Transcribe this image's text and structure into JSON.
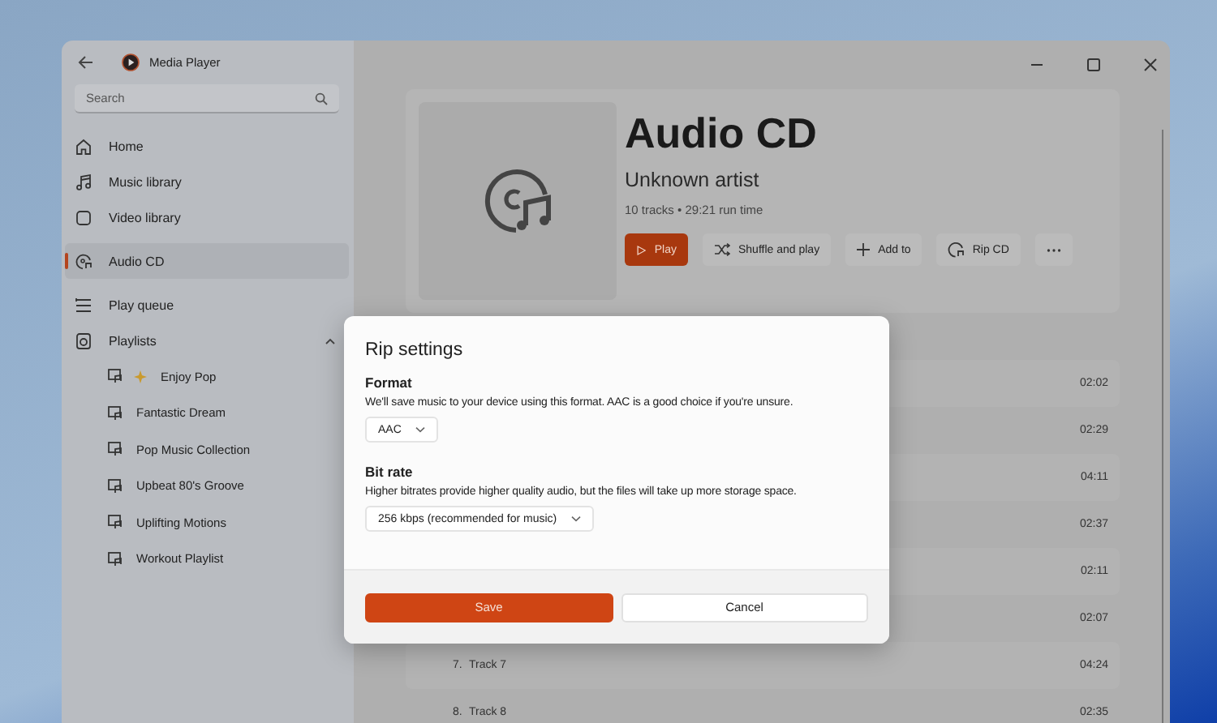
{
  "window": {
    "title": "Media Player"
  },
  "search": {
    "placeholder": "Search"
  },
  "nav_sections": [
    {
      "items": [
        {
          "label": "Home",
          "selected": false
        },
        {
          "label": "Music library",
          "selected": false
        },
        {
          "label": "Video library",
          "selected": false
        }
      ]
    },
    {
      "items": [
        {
          "label": "Audio CD",
          "selected": true
        }
      ]
    },
    {
      "items": [
        {
          "label": "Play queue",
          "selected": false
        },
        {
          "label": "Playlists",
          "selected": false,
          "expanded": true,
          "children": [
            {
              "label": "Enjoy Pop",
              "sparkle": true
            },
            {
              "label": "Fantastic Dream",
              "sparkle": false
            },
            {
              "label": "Pop Music Collection",
              "sparkle": false
            },
            {
              "label": "Upbeat 80's Groove",
              "sparkle": false
            },
            {
              "label": "Uplifting Motions",
              "sparkle": false
            },
            {
              "label": "Workout Playlist",
              "sparkle": false
            }
          ]
        }
      ]
    }
  ],
  "album": {
    "title": "Audio CD",
    "artist": "Unknown artist",
    "meta": "10 tracks • 29:21 run time",
    "actions": [
      {
        "kind": "play",
        "label": "Play"
      },
      {
        "kind": "shuffle",
        "label": "Shuffle and play"
      },
      {
        "kind": "add",
        "label": "Add to"
      },
      {
        "kind": "rip",
        "label": "Rip CD"
      },
      {
        "kind": "more"
      }
    ]
  },
  "tracks": [
    {
      "duration": "02:02"
    },
    {
      "duration": "02:29"
    },
    {
      "duration": "04:11"
    },
    {
      "duration": "02:37"
    },
    {
      "duration": "02:11"
    },
    {
      "duration": "02:07"
    },
    {
      "number": "7.",
      "title": "Track 7",
      "duration": "04:24"
    },
    {
      "number": "8.",
      "title": "Track 8",
      "duration": "02:35"
    }
  ],
  "dialog": {
    "title": "Rip settings",
    "sections": [
      {
        "heading": "Format",
        "description": "We'll save music to your device using this format. AAC is a good choice if you're unsure.",
        "value": "AAC"
      },
      {
        "heading": "Bit rate",
        "description": "Higher bitrates provide higher quality audio, but the files will take up more storage space.",
        "value": "256 kbps (recommended for music)"
      }
    ],
    "buttons": [
      {
        "kind": "primary",
        "label": "Save"
      },
      {
        "kind": "secondary",
        "label": "Cancel"
      }
    ]
  }
}
